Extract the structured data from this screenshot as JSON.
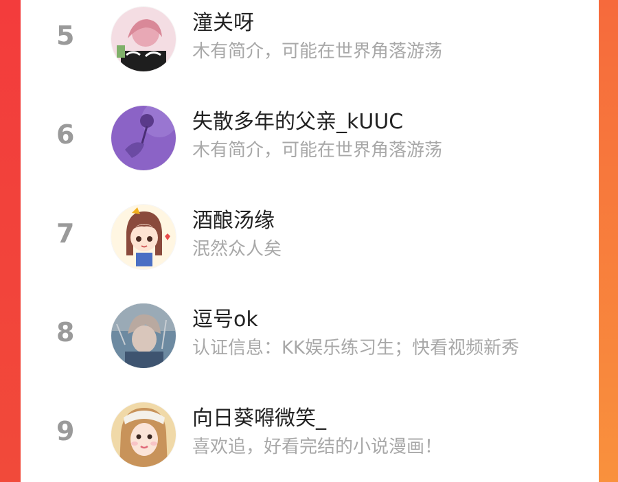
{
  "ranking": {
    "items": [
      {
        "rank": "5",
        "name": "潼关呀",
        "desc": "木有简介，可能在世界角落游荡",
        "avatar_icon": "pink-hair-avatar-icon"
      },
      {
        "rank": "6",
        "name": "失散多年的父亲_kUUC",
        "desc": "木有简介，可能在世界角落游荡",
        "avatar_icon": "purple-rose-avatar-icon"
      },
      {
        "rank": "7",
        "name": "酒酿汤缘",
        "desc": "泯然众人矣",
        "avatar_icon": "cartoon-girl-avatar-icon"
      },
      {
        "rank": "8",
        "name": "逗号ok",
        "desc": "认证信息：KK娱乐练习生；快看视频新秀",
        "avatar_icon": "anime-boy-avatar-icon"
      },
      {
        "rank": "9",
        "name": "向日葵嘚微笑_",
        "desc": "喜欢追，好看完结的小说漫画！",
        "avatar_icon": "girl-photo-avatar-icon"
      }
    ]
  },
  "colors": {
    "background_left": "#f23d3d",
    "background_right": "#f7833e",
    "card": "#ffffff",
    "rank_text": "#9a9a9a",
    "name_text": "#222222",
    "desc_text": "#a8a8a8"
  }
}
